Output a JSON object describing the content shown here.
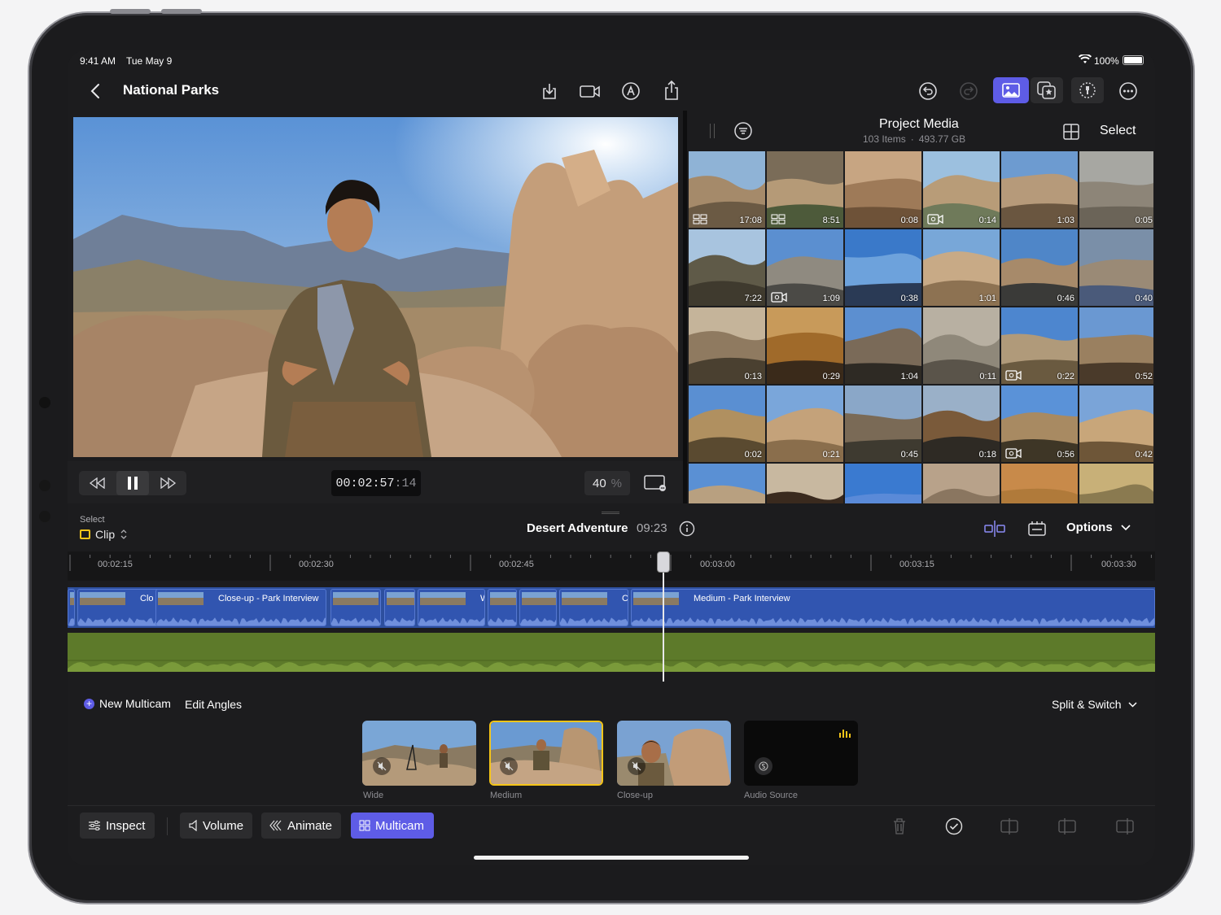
{
  "status": {
    "time": "9:41 AM",
    "date": "Tue May 9",
    "battery": "100%"
  },
  "nav": {
    "title": "National Parks"
  },
  "transport": {
    "timecode_main": "00:02:57",
    "timecode_frames": ":14",
    "zoom_value": "40",
    "zoom_unit": "%"
  },
  "browser": {
    "title": "Project Media",
    "items": "103 Items",
    "separator": "·",
    "size": "493.77 GB",
    "select_label": "Select",
    "thumbs": [
      {
        "dur": "17:08",
        "badge": "multicam",
        "colors": [
          "#8fb3d6",
          "#a58a6a",
          "#6b5a44"
        ]
      },
      {
        "dur": "8:51",
        "badge": "multicam",
        "colors": [
          "#7a6c58",
          "#b59a77",
          "#4d5a3a"
        ]
      },
      {
        "dur": "0:08",
        "badge": "",
        "colors": [
          "#c7a582",
          "#9e7a58",
          "#6e5238"
        ]
      },
      {
        "dur": "0:14",
        "badge": "camera",
        "colors": [
          "#9cc0df",
          "#b89c78",
          "#6f7a5a"
        ]
      },
      {
        "dur": "1:03",
        "badge": "",
        "colors": [
          "#6d9bd0",
          "#b69a7a",
          "#6a5640"
        ]
      },
      {
        "dur": "0:05",
        "badge": "",
        "colors": [
          "#a7a7a2",
          "#8d8578",
          "#6b6458"
        ]
      },
      {
        "dur": "7:22",
        "badge": "",
        "colors": [
          "#a8c4df",
          "#5f5a48",
          "#3f3a2e"
        ]
      },
      {
        "dur": "1:09",
        "badge": "camera",
        "colors": [
          "#5b8fd0",
          "#8f8a80",
          "#4b4a46"
        ]
      },
      {
        "dur": "0:38",
        "badge": "",
        "colors": [
          "#3a79c9",
          "#6da2dc",
          "#2a3a55"
        ]
      },
      {
        "dur": "1:01",
        "badge": "",
        "colors": [
          "#78a7d8",
          "#c8aa86",
          "#8d7252"
        ]
      },
      {
        "dur": "0:46",
        "badge": "",
        "colors": [
          "#4f86c8",
          "#a78a6a",
          "#3a3a38"
        ]
      },
      {
        "dur": "0:40",
        "badge": "",
        "colors": [
          "#7a8fa8",
          "#9a8a76",
          "#4a5a7a"
        ]
      },
      {
        "dur": "0:13",
        "badge": "",
        "colors": [
          "#c5b49a",
          "#8f7a60",
          "#4a4030"
        ]
      },
      {
        "dur": "0:29",
        "badge": "",
        "colors": [
          "#c89a5a",
          "#a06a2a",
          "#3a2a1a"
        ]
      },
      {
        "dur": "1:04",
        "badge": "",
        "colors": [
          "#5c8fd0",
          "#7a6a58",
          "#2e2a24"
        ]
      },
      {
        "dur": "0:11",
        "badge": "",
        "colors": [
          "#b8b0a2",
          "#8f887a",
          "#5a544a"
        ]
      },
      {
        "dur": "0:22",
        "badge": "camera",
        "colors": [
          "#4d86cf",
          "#b09a7a",
          "#6a5a40"
        ]
      },
      {
        "dur": "0:52",
        "badge": "",
        "colors": [
          "#6a98d2",
          "#9a8060",
          "#4a3a2a"
        ]
      },
      {
        "dur": "0:02",
        "badge": "",
        "colors": [
          "#5a8fd2",
          "#b09060",
          "#5a4a30"
        ]
      },
      {
        "dur": "0:21",
        "badge": "",
        "colors": [
          "#7aa6da",
          "#c4a27a",
          "#8a6e4c"
        ]
      },
      {
        "dur": "0:45",
        "badge": "",
        "colors": [
          "#8aa7c8",
          "#7a6a56",
          "#3e3a30"
        ]
      },
      {
        "dur": "0:18",
        "badge": "",
        "colors": [
          "#9ab0c8",
          "#7a5a3a",
          "#2e2a24"
        ]
      },
      {
        "dur": "0:56",
        "badge": "camera",
        "colors": [
          "#5a92d8",
          "#a88a62",
          "#3e3626"
        ]
      },
      {
        "dur": "0:42",
        "badge": "",
        "colors": [
          "#7aa4d8",
          "#c8a67a",
          "#6e5638"
        ]
      },
      {
        "dur": "",
        "badge": "",
        "colors": [
          "#5a90d4",
          "#b8a080",
          "#7a6a50"
        ]
      },
      {
        "dur": "",
        "badge": "",
        "colors": [
          "#c8b8a0",
          "#3a2a1e",
          "#1e1a16"
        ]
      },
      {
        "dur": "",
        "badge": "",
        "colors": [
          "#3a7ad0",
          "#5a8ad8",
          "#1e2a40"
        ]
      },
      {
        "dur": "",
        "badge": "",
        "colors": [
          "#b8a28a",
          "#8a7660",
          "#4a3e30"
        ]
      },
      {
        "dur": "",
        "badge": "",
        "colors": [
          "#c88a4a",
          "#b07a3a",
          "#5a4028"
        ]
      },
      {
        "dur": "",
        "badge": "",
        "colors": [
          "#c8b078",
          "#8a7a50",
          "#4a5a3a"
        ]
      }
    ]
  },
  "timeline": {
    "select_label": "Select",
    "select_value": "Clip",
    "project_name": "Desert Adventure",
    "project_duration": "09:23",
    "options_label": "Options",
    "ruler": [
      "00:02:15",
      "00:02:30",
      "00:02:45",
      "00:03:00",
      "00:03:15",
      "00:03:30"
    ],
    "clips": [
      "Clo",
      "Close-up - Park Interview",
      "",
      "",
      "W",
      "",
      "",
      "Cl",
      "Medium - Park Interview"
    ]
  },
  "multicam": {
    "new_multicam": "New Multicam",
    "edit_angles": "Edit Angles",
    "split_switch": "Split & Switch",
    "angles": [
      {
        "label": "Wide",
        "selected": false
      },
      {
        "label": "Medium",
        "selected": true
      },
      {
        "label": "Close-up",
        "selected": false
      },
      {
        "label": "Audio Source",
        "selected": false
      }
    ]
  },
  "toolbar": {
    "inspect": "Inspect",
    "volume": "Volume",
    "animate": "Animate",
    "multicam": "Multicam"
  },
  "colors": {
    "accent": "#5e5ce6",
    "selection": "#f5c518",
    "video_track": "#3155b0",
    "audio_track": "#5d7a2a"
  }
}
